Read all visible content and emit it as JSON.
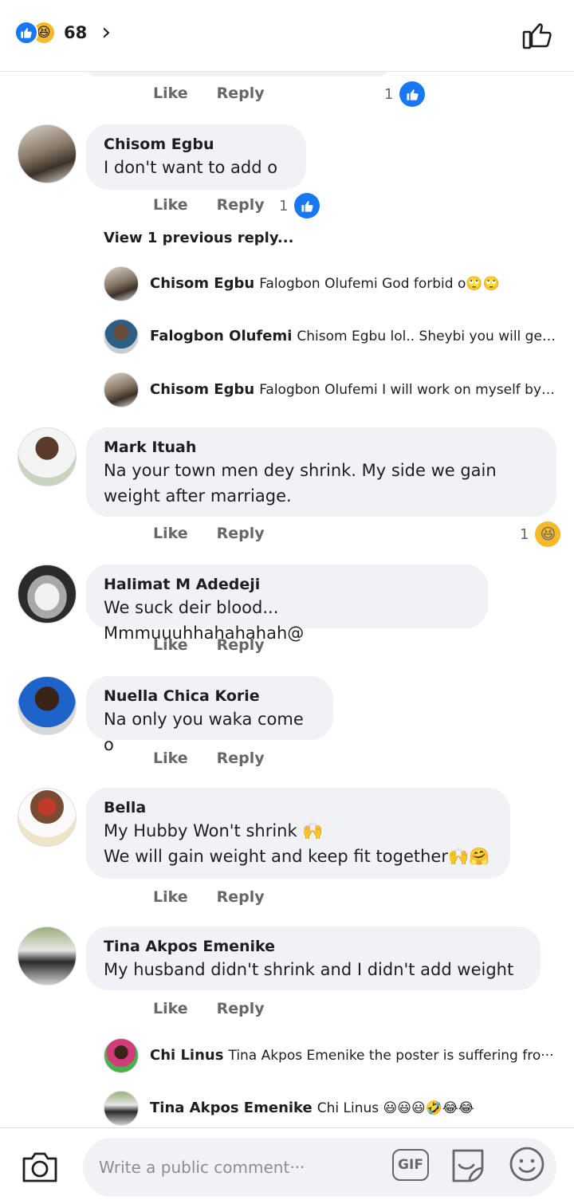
{
  "header": {
    "reaction_count": "68",
    "reactions": [
      "like-icon",
      "haha-icon"
    ],
    "chevron": "›"
  },
  "top_partial": {
    "like": "Like",
    "reply": "Reply",
    "reaction_count": "1"
  },
  "comments": [
    {
      "name": "Chisom Egbu",
      "text": "I don't want to add o",
      "like": "Like",
      "reply": "Reply",
      "reaction_count": "1",
      "reaction": "like"
    },
    {
      "name": "Mark Ituah",
      "text": "Na your town men dey shrink. My side we gain weight after marriage.",
      "like": "Like",
      "reply": "Reply",
      "reaction_count": "1",
      "reaction": "haha"
    },
    {
      "name": "Halimat M Adedeji",
      "text": "We suck deir blood... Mmmuuuhhahahahah@",
      "like": "Like",
      "reply": "Reply"
    },
    {
      "name": "Nuella Chica Korie",
      "text": "Na only you waka come o",
      "like": "Like",
      "reply": "Reply"
    },
    {
      "name": "Bella",
      "text": "My Hubby Won't shrink 🙌",
      "text2": "We will gain weight and keep fit together🙌🤗",
      "like": "Like",
      "reply": "Reply"
    },
    {
      "name": "Tina Akpos Emenike",
      "text": "My husband didn't shrink and I didn't add weight",
      "like": "Like",
      "reply": "Reply"
    }
  ],
  "view_previous": "View 1 previous reply...",
  "replies_chisom": [
    {
      "name": "Chisom Egbu",
      "text": "Falogbon Olufemi God forbid o🙄🙄"
    },
    {
      "name": "Falogbon Olufemi",
      "text": "Chisom Egbu lol.. Sheybi you will get p···"
    },
    {
      "name": "Chisom Egbu",
      "text": "Falogbon Olufemi I will work on myself by ···"
    }
  ],
  "replies_tina": [
    {
      "name": "Chi Linus",
      "text": "Tina Akpos Emenike the poster is suffering fro···"
    },
    {
      "name": "Tina Akpos Emenike",
      "text": "Chi Linus 😃😃😃🤣😂😂"
    }
  ],
  "composer": {
    "placeholder": "Write a public comment···",
    "gif_label": "GIF"
  },
  "colors": {
    "accent": "#1877f2",
    "haha": "#f7b928",
    "bubble": "#f0f2f5",
    "muted": "#65676b"
  }
}
